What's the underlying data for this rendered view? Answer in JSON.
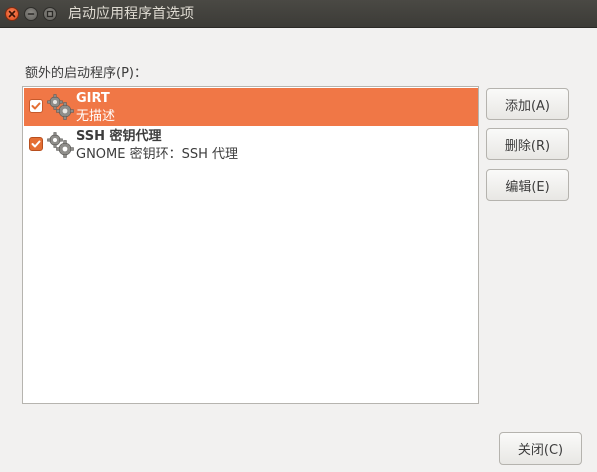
{
  "window": {
    "title": "启动应用程序首选项",
    "controls": [
      "close-icon",
      "minimize-icon",
      "maximize-icon"
    ]
  },
  "section_label": "额外的启动程序(P)：",
  "programs": [
    {
      "name": "GIRT",
      "description": "无描述",
      "enabled": true,
      "selected": true,
      "icon": "gears-icon"
    },
    {
      "name": "SSH 密钥代理",
      "description": "GNOME 密钥环：SSH 代理",
      "enabled": true,
      "selected": false,
      "icon": "gears-icon"
    }
  ],
  "buttons": {
    "add": "添加(A)",
    "remove": "删除(R)",
    "edit": "编辑(E)",
    "close": "关闭(C)"
  },
  "colors": {
    "selection": "#f07746",
    "titlebar": "#3c3b37",
    "close_button": "#df4a16"
  }
}
